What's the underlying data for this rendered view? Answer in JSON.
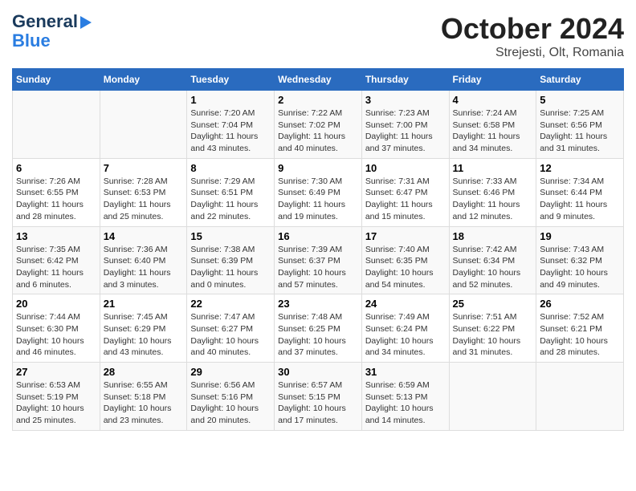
{
  "header": {
    "logo_line1": "General",
    "logo_line2": "Blue",
    "title": "October 2024",
    "location": "Strejesti, Olt, Romania"
  },
  "weekdays": [
    "Sunday",
    "Monday",
    "Tuesday",
    "Wednesday",
    "Thursday",
    "Friday",
    "Saturday"
  ],
  "weeks": [
    [
      {
        "day": "",
        "info": ""
      },
      {
        "day": "",
        "info": ""
      },
      {
        "day": "1",
        "info": "Sunrise: 7:20 AM\nSunset: 7:04 PM\nDaylight: 11 hours and 43 minutes."
      },
      {
        "day": "2",
        "info": "Sunrise: 7:22 AM\nSunset: 7:02 PM\nDaylight: 11 hours and 40 minutes."
      },
      {
        "day": "3",
        "info": "Sunrise: 7:23 AM\nSunset: 7:00 PM\nDaylight: 11 hours and 37 minutes."
      },
      {
        "day": "4",
        "info": "Sunrise: 7:24 AM\nSunset: 6:58 PM\nDaylight: 11 hours and 34 minutes."
      },
      {
        "day": "5",
        "info": "Sunrise: 7:25 AM\nSunset: 6:56 PM\nDaylight: 11 hours and 31 minutes."
      }
    ],
    [
      {
        "day": "6",
        "info": "Sunrise: 7:26 AM\nSunset: 6:55 PM\nDaylight: 11 hours and 28 minutes."
      },
      {
        "day": "7",
        "info": "Sunrise: 7:28 AM\nSunset: 6:53 PM\nDaylight: 11 hours and 25 minutes."
      },
      {
        "day": "8",
        "info": "Sunrise: 7:29 AM\nSunset: 6:51 PM\nDaylight: 11 hours and 22 minutes."
      },
      {
        "day": "9",
        "info": "Sunrise: 7:30 AM\nSunset: 6:49 PM\nDaylight: 11 hours and 19 minutes."
      },
      {
        "day": "10",
        "info": "Sunrise: 7:31 AM\nSunset: 6:47 PM\nDaylight: 11 hours and 15 minutes."
      },
      {
        "day": "11",
        "info": "Sunrise: 7:33 AM\nSunset: 6:46 PM\nDaylight: 11 hours and 12 minutes."
      },
      {
        "day": "12",
        "info": "Sunrise: 7:34 AM\nSunset: 6:44 PM\nDaylight: 11 hours and 9 minutes."
      }
    ],
    [
      {
        "day": "13",
        "info": "Sunrise: 7:35 AM\nSunset: 6:42 PM\nDaylight: 11 hours and 6 minutes."
      },
      {
        "day": "14",
        "info": "Sunrise: 7:36 AM\nSunset: 6:40 PM\nDaylight: 11 hours and 3 minutes."
      },
      {
        "day": "15",
        "info": "Sunrise: 7:38 AM\nSunset: 6:39 PM\nDaylight: 11 hours and 0 minutes."
      },
      {
        "day": "16",
        "info": "Sunrise: 7:39 AM\nSunset: 6:37 PM\nDaylight: 10 hours and 57 minutes."
      },
      {
        "day": "17",
        "info": "Sunrise: 7:40 AM\nSunset: 6:35 PM\nDaylight: 10 hours and 54 minutes."
      },
      {
        "day": "18",
        "info": "Sunrise: 7:42 AM\nSunset: 6:34 PM\nDaylight: 10 hours and 52 minutes."
      },
      {
        "day": "19",
        "info": "Sunrise: 7:43 AM\nSunset: 6:32 PM\nDaylight: 10 hours and 49 minutes."
      }
    ],
    [
      {
        "day": "20",
        "info": "Sunrise: 7:44 AM\nSunset: 6:30 PM\nDaylight: 10 hours and 46 minutes."
      },
      {
        "day": "21",
        "info": "Sunrise: 7:45 AM\nSunset: 6:29 PM\nDaylight: 10 hours and 43 minutes."
      },
      {
        "day": "22",
        "info": "Sunrise: 7:47 AM\nSunset: 6:27 PM\nDaylight: 10 hours and 40 minutes."
      },
      {
        "day": "23",
        "info": "Sunrise: 7:48 AM\nSunset: 6:25 PM\nDaylight: 10 hours and 37 minutes."
      },
      {
        "day": "24",
        "info": "Sunrise: 7:49 AM\nSunset: 6:24 PM\nDaylight: 10 hours and 34 minutes."
      },
      {
        "day": "25",
        "info": "Sunrise: 7:51 AM\nSunset: 6:22 PM\nDaylight: 10 hours and 31 minutes."
      },
      {
        "day": "26",
        "info": "Sunrise: 7:52 AM\nSunset: 6:21 PM\nDaylight: 10 hours and 28 minutes."
      }
    ],
    [
      {
        "day": "27",
        "info": "Sunrise: 6:53 AM\nSunset: 5:19 PM\nDaylight: 10 hours and 25 minutes."
      },
      {
        "day": "28",
        "info": "Sunrise: 6:55 AM\nSunset: 5:18 PM\nDaylight: 10 hours and 23 minutes."
      },
      {
        "day": "29",
        "info": "Sunrise: 6:56 AM\nSunset: 5:16 PM\nDaylight: 10 hours and 20 minutes."
      },
      {
        "day": "30",
        "info": "Sunrise: 6:57 AM\nSunset: 5:15 PM\nDaylight: 10 hours and 17 minutes."
      },
      {
        "day": "31",
        "info": "Sunrise: 6:59 AM\nSunset: 5:13 PM\nDaylight: 10 hours and 14 minutes."
      },
      {
        "day": "",
        "info": ""
      },
      {
        "day": "",
        "info": ""
      }
    ]
  ]
}
